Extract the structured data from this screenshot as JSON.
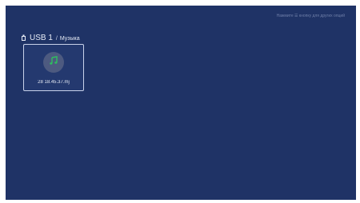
{
  "header": {
    "hint_text": "Нажмите ☰ кнопку для других опций"
  },
  "breadcrumb": {
    "root": "USB 1",
    "separator": "/",
    "folder": "Музыка"
  },
  "files": [
    {
      "name": "28 18.45.37.mj",
      "icon": "music-note-icon",
      "selected": true
    }
  ],
  "colors": {
    "background": "#1f3366",
    "accent_icon": "#2fbf5f"
  }
}
